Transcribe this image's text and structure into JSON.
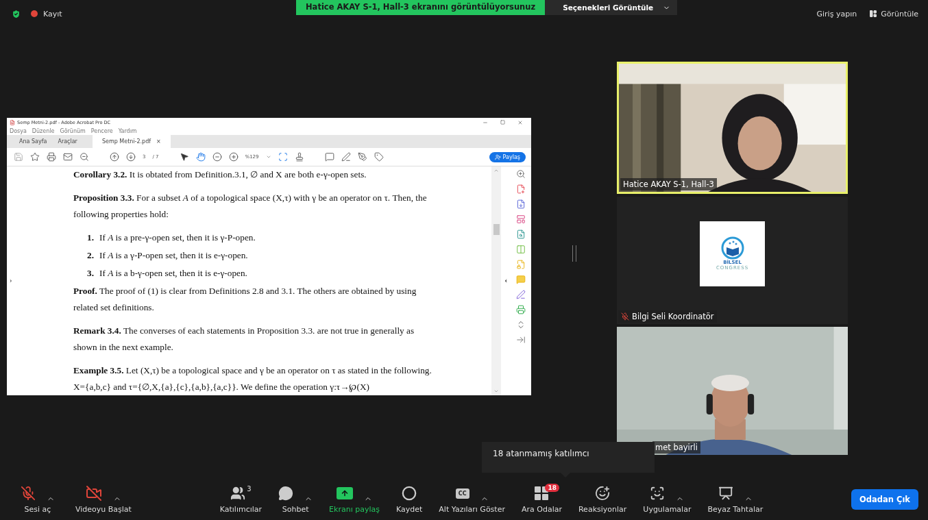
{
  "topbar": {
    "recording": "Kayıt",
    "banner": "Hatice AKAY S-1, Hall-3 ekranını görüntülüyorsunuz",
    "view_options": "Seçenekleri Görüntüle",
    "sign_in": "Giriş yapın",
    "view": "Görüntüle"
  },
  "shared_screen": {
    "title": "Semp Metni-2.pdf - Adobe Acrobat Pro DC",
    "menu": [
      "Dosya",
      "Düzenle",
      "Görünüm",
      "Pencere",
      "Yardım"
    ],
    "tabs": [
      {
        "label": "Ana Sayfa",
        "selected": false
      },
      {
        "label": "Araçlar",
        "selected": false
      },
      {
        "label": "Semp Metni-2.pdf",
        "selected": true,
        "close": "×"
      }
    ],
    "page_number": "3",
    "page_total": "/ 7",
    "zoom": "%129",
    "share_button": "Paylaş",
    "document": [
      {
        "kind": "para",
        "text": "**Corollary 3.2.** It is obtated from Definition.3.1, ∅ and X are both e-γ-open sets."
      },
      {
        "kind": "para",
        "text": "**Proposition 3.3.** For a subset *A* of a topological space (X,τ) with γ be an operator on τ. Then, the following properties hold:"
      },
      {
        "kind": "item",
        "number": "1.",
        "text": "If *A* is a pre-γ-open set, then it is γ-P-open."
      },
      {
        "kind": "item",
        "number": "2.",
        "text": "If *A* is a γ-P-open set, then it is e-γ-open."
      },
      {
        "kind": "item",
        "number": "3.",
        "text": "If *A* is a b-γ-open set, then it is e-γ-open."
      },
      {
        "kind": "para",
        "text": "**Proof.** The proof of (1) is clear from Definitions 2.8 and 3.1. The others are obtained by using related set definitions."
      },
      {
        "kind": "para",
        "text": "**Remark 3.4.** The converses of each statements in Proposition 3.3. are not true in generally as shown in the next example."
      },
      {
        "kind": "para",
        "text": "**Example 3.5.** Let (X,τ) be a topological space and γ be an operator on τ as stated in the following. X={a,b,c} and τ={∅,X,{a},{c},{a,b},{a,c}}. We define the operation γ:τ→℘(X)"
      }
    ]
  },
  "videos": [
    {
      "kind": "camera",
      "name": "Hatice AKAY S-1, Hall-3",
      "active": true,
      "muted": false
    },
    {
      "kind": "logo",
      "name": "Bilgi Seli Koordinatör",
      "active": false,
      "muted": true,
      "logo_text": "BİLSEL",
      "logo_subtext": "CONGRESS"
    },
    {
      "kind": "camera2",
      "name": "met bayirli",
      "active": false,
      "muted": false
    }
  ],
  "tooltip": "18 atanmamış katılımcı",
  "toolbar": [
    {
      "kind": "mic",
      "label": "Sesi aç",
      "caret": true,
      "off": true,
      "highlighted": false
    },
    {
      "kind": "video",
      "label": "Videoyu Başlat",
      "caret": true,
      "off": true,
      "highlighted": false
    },
    {
      "kind": "participants",
      "label": "Katılımcılar",
      "count": "3",
      "caret": false,
      "highlighted": false
    },
    {
      "kind": "chat",
      "label": "Sohbet",
      "caret": true,
      "highlighted": false
    },
    {
      "kind": "share",
      "label": "Ekranı paylaş",
      "caret": true,
      "highlighted": true
    },
    {
      "kind": "record",
      "label": "Kaydet",
      "caret": false,
      "highlighted": false
    },
    {
      "kind": "captions",
      "label": "Alt Yazıları Göster",
      "glyph": "CC",
      "caret": true,
      "highlighted": false
    },
    {
      "kind": "rooms",
      "label": "Ara Odalar",
      "badge": "18",
      "caret": false,
      "highlighted": false
    },
    {
      "kind": "reactions",
      "label": "Reaksiyonlar",
      "caret": false,
      "highlighted": false
    },
    {
      "kind": "apps",
      "label": "Uygulamalar",
      "caret": true,
      "highlighted": false
    },
    {
      "kind": "whiteboard",
      "label": "Beyaz Tahtalar",
      "caret": true,
      "highlighted": false
    }
  ],
  "leave_button": "Odadan Çık"
}
